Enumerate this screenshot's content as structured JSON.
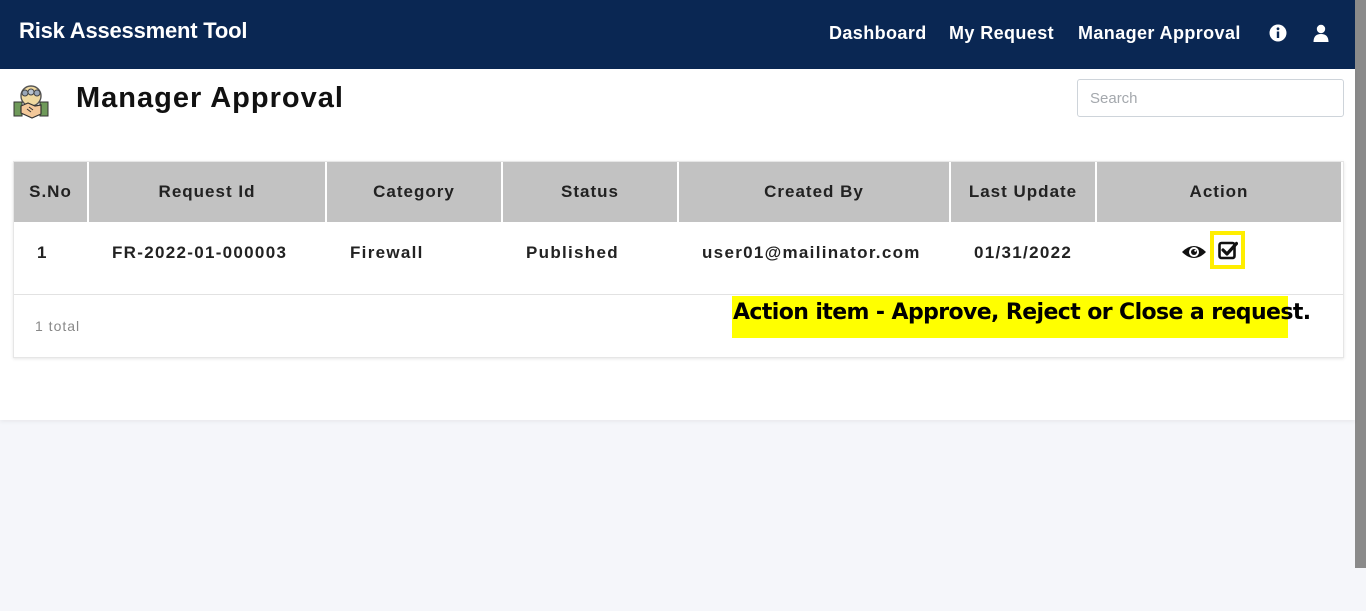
{
  "app": {
    "title": "Risk Assessment Tool"
  },
  "nav": {
    "links": [
      "Dashboard",
      "My Request",
      "Manager Approval"
    ],
    "icons": [
      "info-icon",
      "user-icon"
    ]
  },
  "page": {
    "title": "Manager Approval",
    "icon": "manager-handshake-icon"
  },
  "search": {
    "placeholder": "Search",
    "value": ""
  },
  "table": {
    "columns": [
      "S.No",
      "Request Id",
      "Category",
      "Status",
      "Created By",
      "Last Update",
      "Action"
    ],
    "rows": [
      {
        "sno": "1",
        "request_id": "FR-2022-01-000003",
        "category": "Firewall",
        "status": "Published",
        "created_by": "user01@mailinator.com",
        "last_update": "01/31/2022",
        "actions": [
          "eye-icon",
          "check-square-icon"
        ]
      }
    ],
    "footer": "1 total"
  },
  "annotation": {
    "text": "Action item - Approve, Reject or Close a request.",
    "highlight_color": "#ffff00"
  },
  "colors": {
    "navbar": "#0a2753",
    "header_bg": "#c2c2c2",
    "page_bg": "#f5f6fa",
    "highlight_border": "#ffee00"
  }
}
